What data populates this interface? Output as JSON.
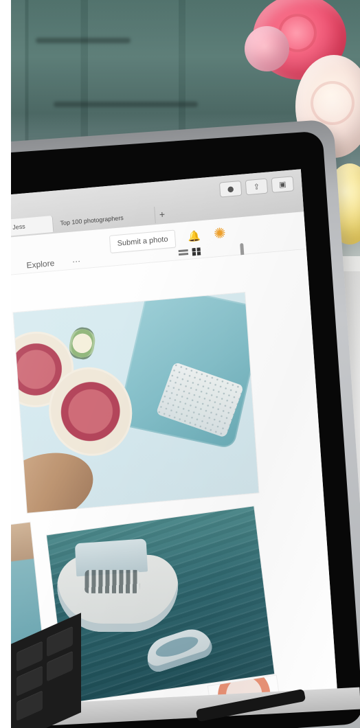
{
  "browser": {
    "tabs": [
      {
        "label": "ck — Designed by Jess"
      },
      {
        "label": "Top 100 photographers"
      }
    ],
    "new_tab_icon": "+",
    "download_icon": "download-icon",
    "share_icon": "share-icon",
    "tabs_icon": "tabs-icon"
  },
  "site": {
    "nav": {
      "explore_label": "Explore",
      "more_label": "···"
    },
    "submit_label": "Submit a photo",
    "bell_icon": "bell-icon",
    "logo_icon": "logo-icon",
    "view_list_icon": "list-view-icon",
    "view_grid_icon": "grid-view-icon"
  }
}
